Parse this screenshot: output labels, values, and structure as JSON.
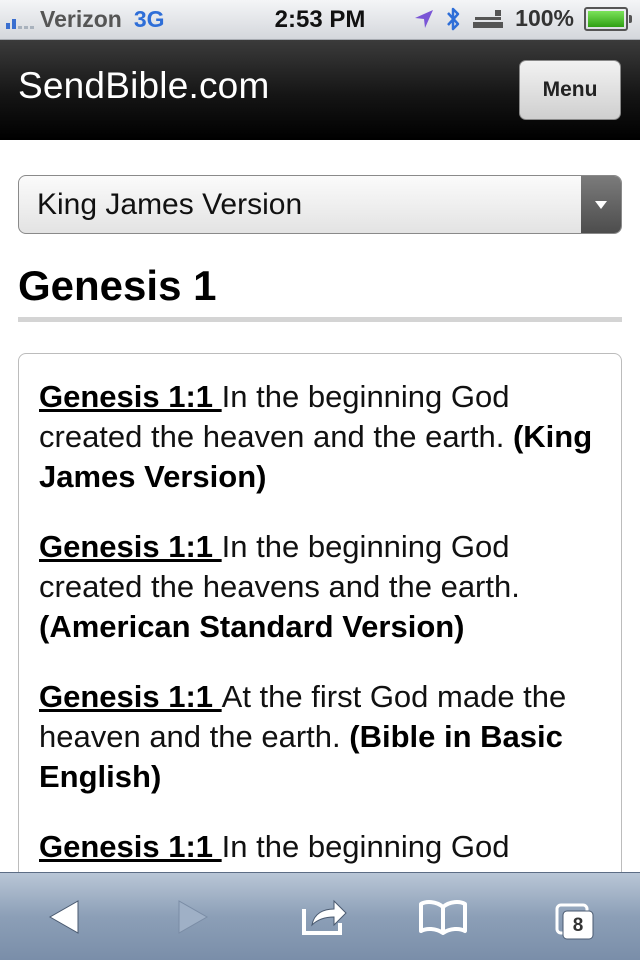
{
  "status_bar": {
    "carrier": "Verizon",
    "network": "3G",
    "time": "2:53 PM",
    "battery": "100%",
    "battery_level": 1.0,
    "signal_bars": 2,
    "icons": [
      "signal-icon",
      "location-icon",
      "bluetooth-icon",
      "alarm-icon",
      "battery-icon"
    ]
  },
  "header": {
    "site_title": "SendBible.com",
    "menu_label": "Menu"
  },
  "version_select": {
    "selected": "King James Version"
  },
  "chapter": {
    "title": "Genesis 1"
  },
  "verses": [
    {
      "ref": "Genesis 1:1 ",
      "text": "In the beginning God created the heaven and the earth. ",
      "version": "(King James Version)"
    },
    {
      "ref": "Genesis 1:1 ",
      "text": "In the beginning God created the heavens and the earth. ",
      "version": "(American Standard Version)"
    },
    {
      "ref": "Genesis 1:1 ",
      "text": "At the first God made the heaven and the earth. ",
      "version": "(Bible in Basic English)"
    },
    {
      "ref": "Genesis 1:1 ",
      "text": "In the beginning God",
      "version": ""
    }
  ],
  "toolbar": {
    "tabs_count": "8",
    "icons": [
      "back-icon",
      "forward-icon",
      "share-icon",
      "bookmarks-icon",
      "tabs-icon"
    ]
  },
  "colors": {
    "header_bg": "#000000",
    "toolbar_bg": "#8c9fb7",
    "network_blue": "#2e6ed8"
  }
}
